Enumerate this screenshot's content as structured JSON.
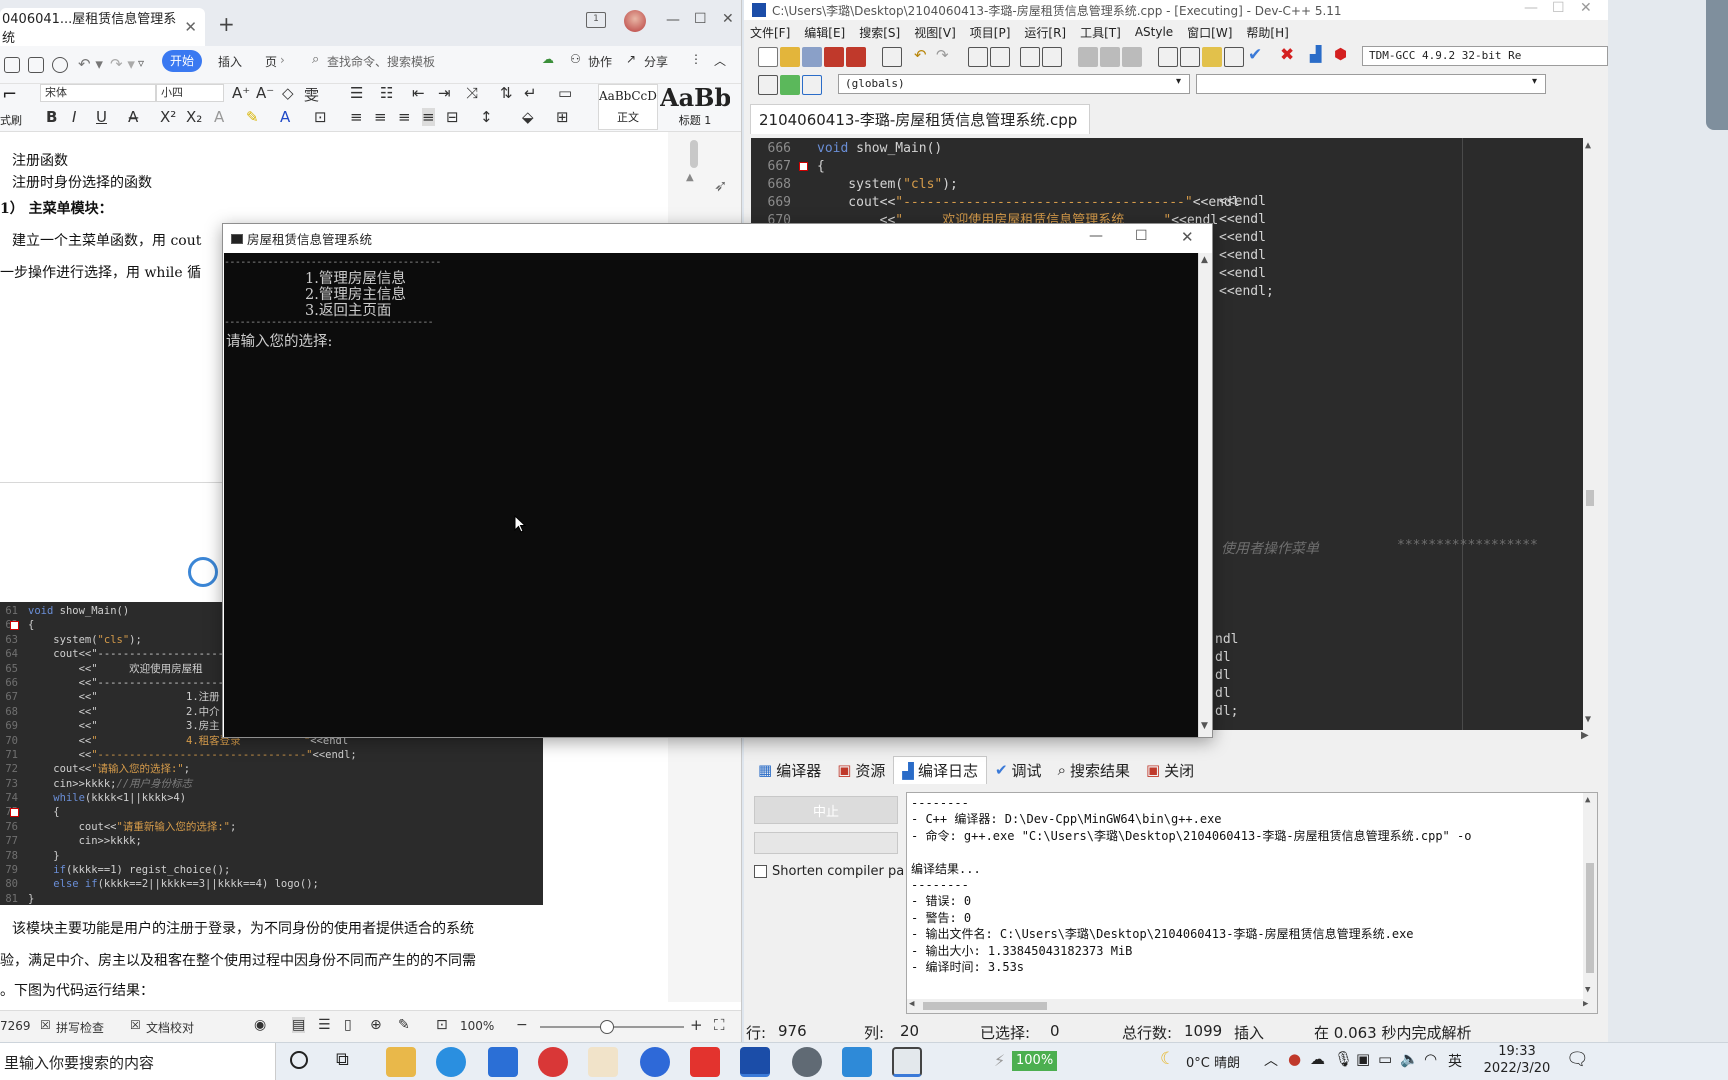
{
  "wps": {
    "tab_title": "0406041...屋租赁信息管理系统",
    "menu": {
      "start": "开始",
      "insert": "插入",
      "page": "页",
      "search_placeholder": "查找命令、搜索模板",
      "collab": "协作",
      "share": "分享"
    },
    "ribbon": {
      "font": "宋体",
      "size": "小四",
      "format_painter": "式刷",
      "style_normal_preview": "AaBbCcDd",
      "style_normal": "正文",
      "style_h1_preview": "AaBb",
      "style_h1": "标题 1"
    },
    "doc_lines": [
      "注册函数",
      "注册时身份选择的函数",
      "1）  主菜单模块：",
      "建立一个主菜单函数，用 cout",
      "一步操作进行选择，用 while 循"
    ],
    "snippet": [
      {
        "n": "61",
        "t": "void show_Main()"
      },
      {
        "n": "62",
        "t": "{"
      },
      {
        "n": "63",
        "t": "    system(\"cls\");"
      },
      {
        "n": "64",
        "t": "    cout<<\"------------------------"
      },
      {
        "n": "65",
        "t": "        <<\"     欢迎使用房屋租"
      },
      {
        "n": "66",
        "t": "        <<\"---------------------"
      },
      {
        "n": "67",
        "t": "        <<\"              1.注册"
      },
      {
        "n": "68",
        "t": "        <<\"              2.中介"
      },
      {
        "n": "69",
        "t": "        <<\"              3.房主"
      },
      {
        "n": "70",
        "t": "        <<\"              4.租客登录          \"<<endl"
      },
      {
        "n": "71",
        "t": "        <<\"---------------------------------\"<<endl;"
      },
      {
        "n": "72",
        "t": "    cout<<\"请输入您的选择:\";"
      },
      {
        "n": "73",
        "t": "    cin>>kkkk;//用户身份标志"
      },
      {
        "n": "74",
        "t": "    while(kkkk<1||kkkk>4)"
      },
      {
        "n": "75",
        "t": "    {"
      },
      {
        "n": "76",
        "t": "        cout<<\"请重新输入您的选择:\";"
      },
      {
        "n": "77",
        "t": "        cin>>kkkk;"
      },
      {
        "n": "78",
        "t": "    }"
      },
      {
        "n": "79",
        "t": "    if(kkkk==1) regist_choice();"
      },
      {
        "n": "80",
        "t": "    else if(kkkk==2||kkkk==3||kkkk==4) logo();"
      },
      {
        "n": "81",
        "t": "}"
      }
    ],
    "after_lines": [
      "该模块主要功能是用户的注册于登录，为不同身份的使用者提供适合的系统",
      "验，满足中介、房主以及租客在整个使用过程中因身份不同而产生的的不同需",
      "。下图为代码运行结果："
    ],
    "status": {
      "words": "7269",
      "spell": "拼写检查",
      "proof": "文档校对",
      "zoom": "100%"
    }
  },
  "devcpp": {
    "title": "C:\\Users\\李璐\\Desktop\\2104060413-李璐-房屋租赁信息管理系统.cpp - [Executing] - Dev-C++ 5.11",
    "menu": [
      "文件[F]",
      "编辑[E]",
      "搜索[S]",
      "视图[V]",
      "项目[P]",
      "运行[R]",
      "工具[T]",
      "AStyle",
      "窗口[W]",
      "帮助[H]"
    ],
    "compiler": "TDM-GCC 4.9.2 32-bit Re",
    "globals": "(globals)",
    "file_tab": "2104060413-李璐-房屋租赁信息管理系统.cpp",
    "editor": [
      {
        "n": "666",
        "t": "void show_Main()"
      },
      {
        "n": "667",
        "t": "{"
      },
      {
        "n": "668",
        "t": "    system(\"cls\");"
      },
      {
        "n": "669",
        "t": "    cout<<\"------------------------------------\"<<endl"
      },
      {
        "n": "670",
        "t": "        <<\"     欢迎使用房屋租赁信息管理系统     \"<<endl"
      }
    ],
    "editor_right_fragments": [
      "<<endl",
      "<<endl",
      "<<endl",
      "<<endl",
      "<<endl",
      "<<endl;"
    ],
    "editor_comment": "使用者操作菜单",
    "editor_stars": "******************",
    "editor_lower_fragments": [
      "ndl",
      "dl",
      "dl",
      "dl",
      "dl;"
    ],
    "bottom_tabs": [
      "编译器",
      "资源",
      "编译日志",
      "调试",
      "搜索结果",
      "关闭"
    ],
    "abort": "中止",
    "shorten": "Shorten compiler pa",
    "log": [
      "--------",
      "- C++ 编译器: D:\\Dev-Cpp\\MinGW64\\bin\\g++.exe",
      "- 命令: g++.exe \"C:\\Users\\李璐\\Desktop\\2104060413-李璐-房屋租赁信息管理系统.cpp\" -o",
      "",
      "编译结果...",
      "--------",
      "- 错误: 0",
      "- 警告: 0",
      "- 输出文件名: C:\\Users\\李璐\\Desktop\\2104060413-李璐-房屋租赁信息管理系统.exe",
      "- 输出大小: 1.33845043182373 MiB",
      "- 编译时间: 3.53s"
    ],
    "status": {
      "line_label": "行:",
      "line": "976",
      "col_label": "列:",
      "col": "20",
      "sel_label": "已选择:",
      "sel": "0",
      "total_label": "总行数:",
      "total": "1099",
      "mode": "插入",
      "parse": "在 0.063 秒内完成解析"
    }
  },
  "console": {
    "title": "房屋租赁信息管理系统",
    "line_top": "----------------------------------------",
    "items": [
      "1.管理房屋信息",
      "2.管理房主信息",
      "3.返回主页面"
    ],
    "line_bottom": "----------------------------------------",
    "prompt": "请输入您的选择:"
  },
  "taskbar": {
    "search": "里输入你要搜索的内容",
    "battery": "100%",
    "weather": "0°C 晴朗",
    "ime": "英",
    "time": "19:33",
    "date": "2022/3/20"
  }
}
